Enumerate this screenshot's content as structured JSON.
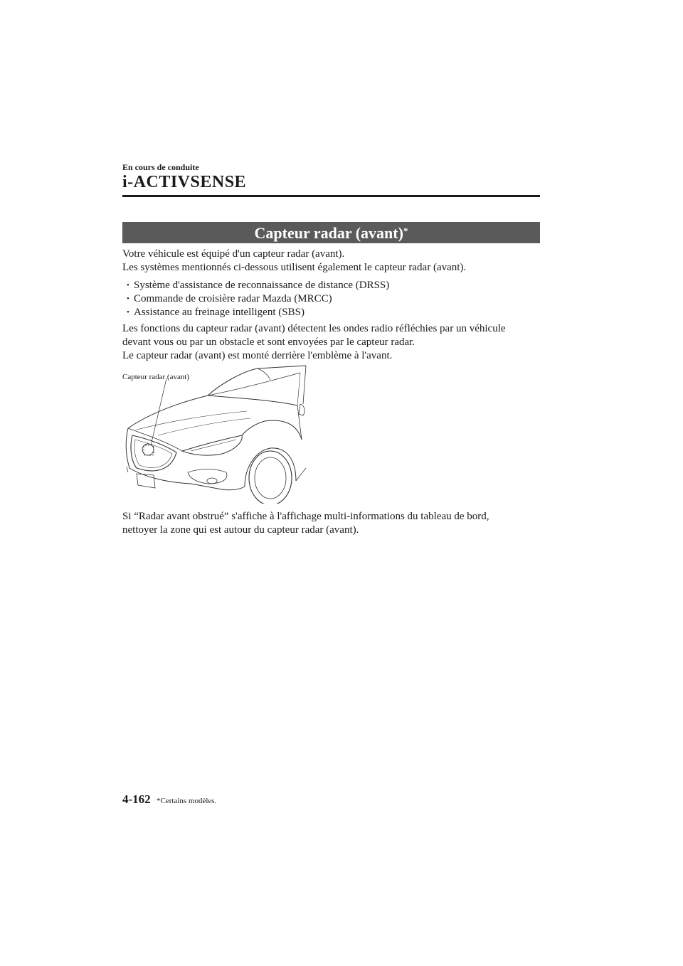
{
  "header": {
    "section_label": "En cours de conduite",
    "chapter_title": "i-ACTIVSENSE"
  },
  "section": {
    "title": "Capteur radar (avant)",
    "title_marker": "*"
  },
  "intro": [
    "Votre véhicule est équipé d'un capteur radar (avant).",
    "Les systèmes mentionnés ci-dessous utilisent également le capteur radar (avant)."
  ],
  "bullet_marker": "•",
  "bullets": [
    "Système d'assistance de reconnaissance de distance (DRSS)",
    "Commande de croisière radar Mazda (MRCC)",
    "Assistance au freinage intelligent (SBS)"
  ],
  "functions": [
    "Les fonctions du capteur radar (avant) détectent les ondes radio réfléchies par un véhicule",
    "devant vous ou par un obstacle et sont envoyées par le capteur radar.",
    "Le capteur radar (avant) est monté derrière l'emblème à l'avant."
  ],
  "figure": {
    "callout_label": "Capteur radar (avant)"
  },
  "closing": [
    "Si “Radar avant obstrué” s'affiche à l'affichage multi-informations du tableau de bord,",
    "nettoyer la zone qui est autour du capteur radar (avant)."
  ],
  "footer": {
    "page_number": "4-162",
    "footnote": "*Certains modèles."
  }
}
